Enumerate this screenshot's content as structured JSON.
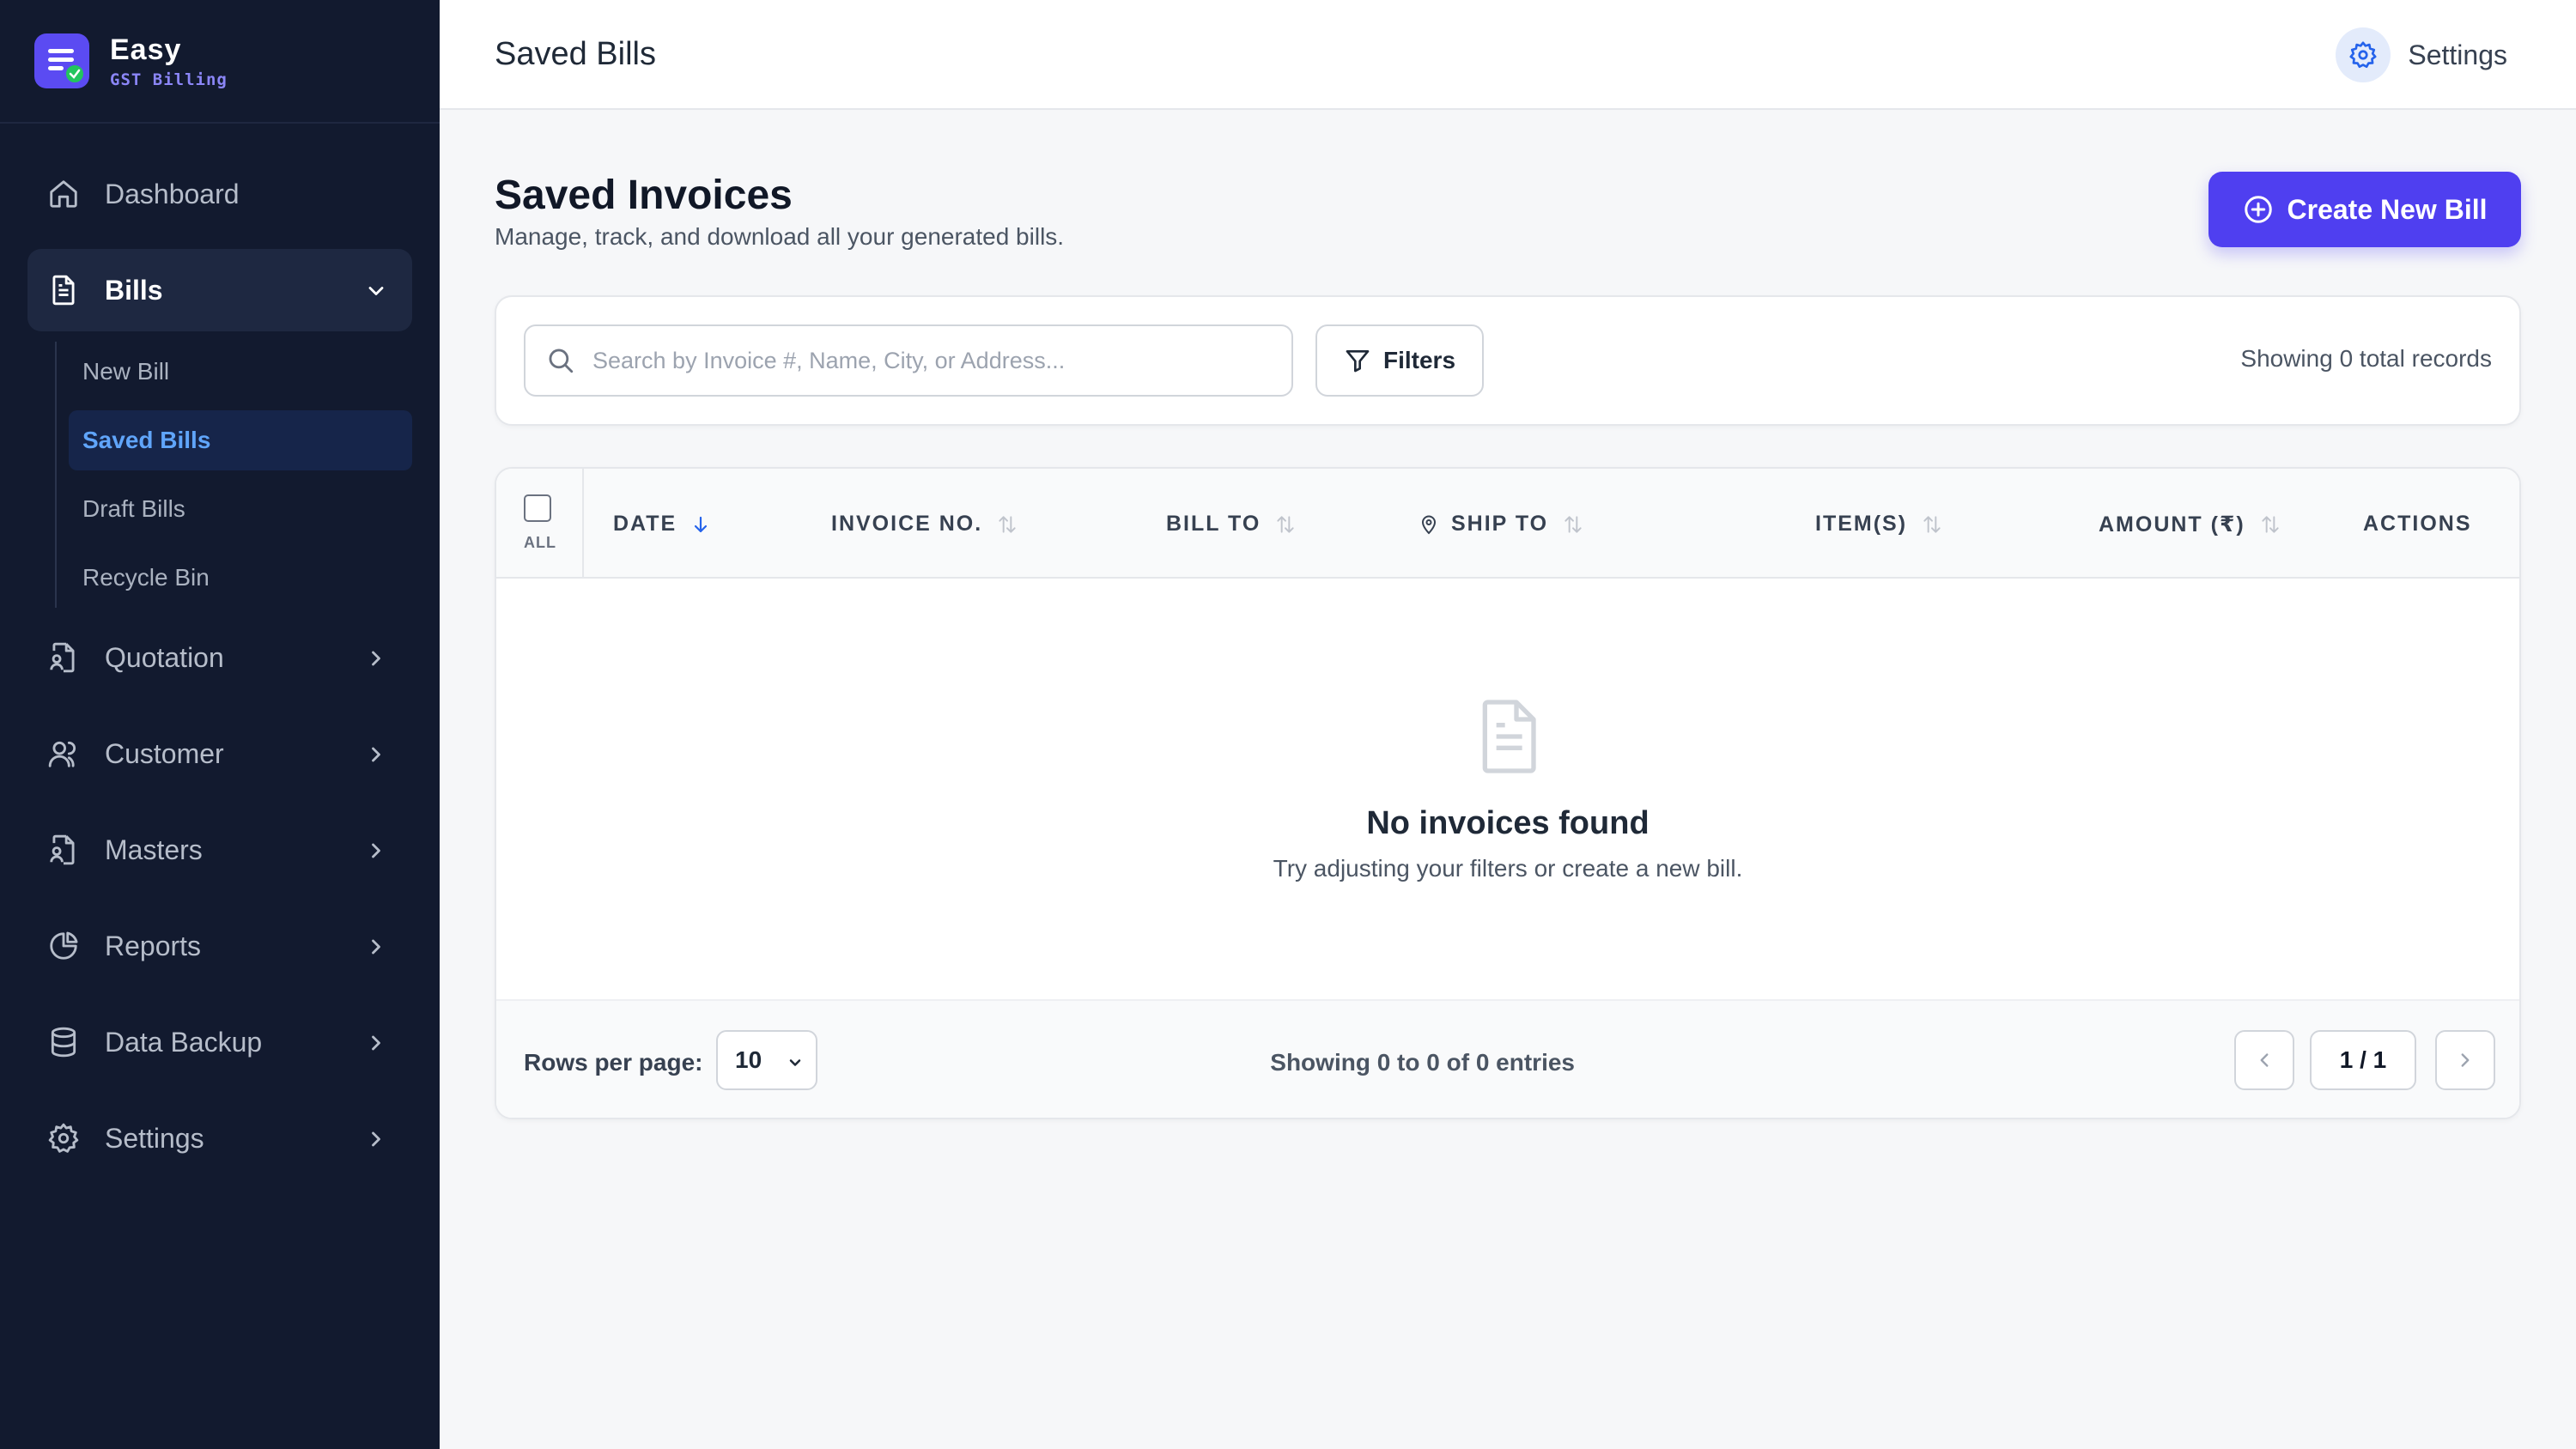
{
  "brand": {
    "name": "Easy",
    "subtitle": "GST Billing"
  },
  "sidebar": {
    "items": [
      {
        "label": "Dashboard",
        "icon": "home-icon"
      },
      {
        "label": "Bills",
        "icon": "file-text-icon",
        "expanded": true,
        "children": [
          {
            "label": "New Bill"
          },
          {
            "label": "Saved Bills",
            "active": true
          },
          {
            "label": "Draft Bills"
          },
          {
            "label": "Recycle Bin"
          }
        ]
      },
      {
        "label": "Quotation",
        "icon": "file-user-icon"
      },
      {
        "label": "Customer",
        "icon": "users-icon"
      },
      {
        "label": "Masters",
        "icon": "file-user-icon"
      },
      {
        "label": "Reports",
        "icon": "pie-chart-icon"
      },
      {
        "label": "Data Backup",
        "icon": "database-icon"
      },
      {
        "label": "Settings",
        "icon": "gear-icon"
      }
    ]
  },
  "topbar": {
    "title": "Saved Bills",
    "settings_label": "Settings"
  },
  "page": {
    "title": "Saved Invoices",
    "subtitle": "Manage, track, and download all your generated bills.",
    "create_button": "Create New Bill"
  },
  "search": {
    "placeholder": "Search by Invoice #, Name, City, or Address...",
    "value": "",
    "filters_label": "Filters",
    "records_text": "Showing 0 total records"
  },
  "table": {
    "select_all_label": "ALL",
    "columns": [
      "DATE",
      "INVOICE NO.",
      "BILL TO",
      "SHIP TO",
      "ITEM(S)",
      "AMOUNT (₹)",
      "ACTIONS"
    ],
    "rows": [],
    "empty_title": "No invoices found",
    "empty_subtitle": "Try adjusting your filters or create a new bill."
  },
  "pagination": {
    "rows_label": "Rows per page:",
    "rows_per_page": "10",
    "entries_text": "Showing 0 to 0 of 0 entries",
    "page_indicator": "1 / 1"
  },
  "colors": {
    "sidebar_bg": "#121a2f",
    "accent": "#4f3ff0",
    "active_link": "#60a5fa",
    "success": "#22c55e"
  }
}
